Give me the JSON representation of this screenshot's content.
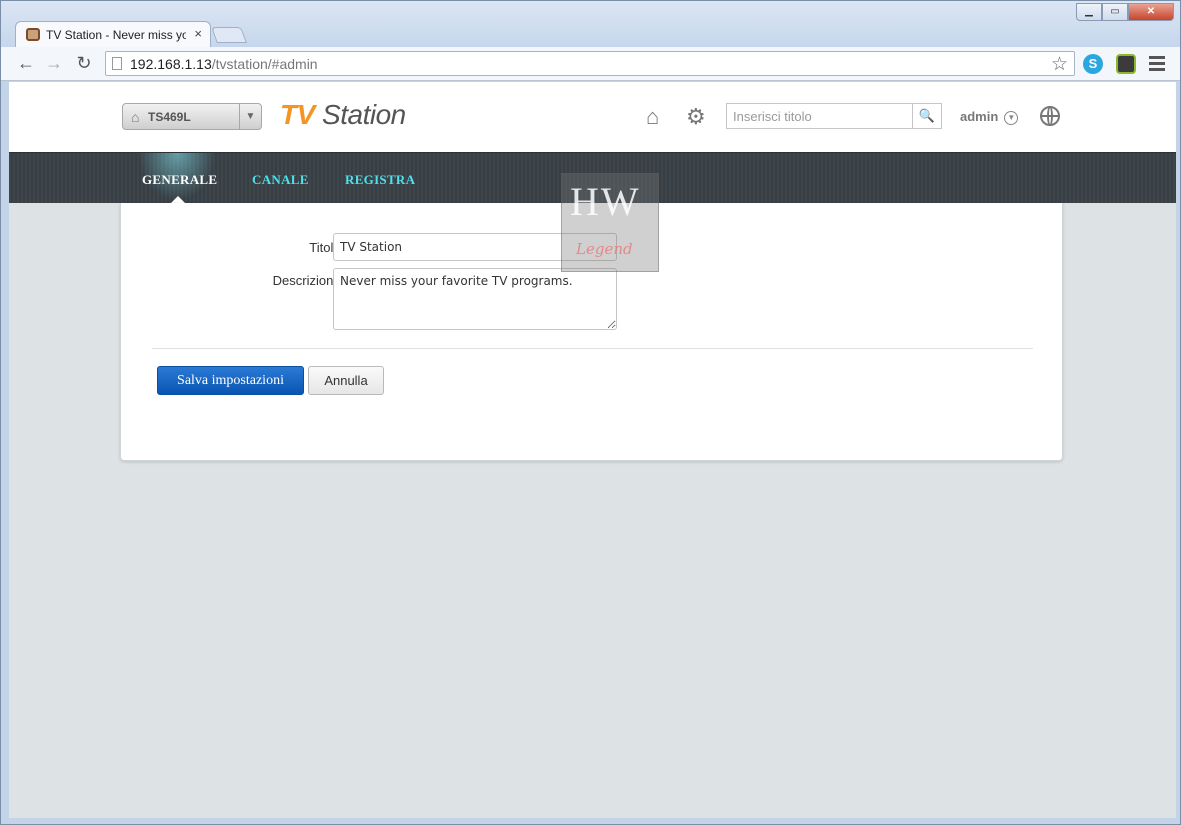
{
  "browser": {
    "tab_title": "TV Station - Never miss your favorite TV programs",
    "tab_close": "×",
    "url_host": "192.168.1.13",
    "url_path": "/tvstation/#admin",
    "window_buttons": {
      "minimize": "▁",
      "maximize": "▭",
      "close": "✕"
    }
  },
  "header": {
    "nas_name": "TS469L",
    "logo_tv": "TV",
    "logo_station": " Station",
    "search_placeholder": "Inserisci titolo",
    "user": "admin"
  },
  "nav": {
    "items": [
      {
        "label": "GENERALE",
        "active": true
      },
      {
        "label": "CANALE",
        "active": false
      },
      {
        "label": "REGISTRA",
        "active": false
      }
    ]
  },
  "form": {
    "title_label": "Titolo di TV Station:",
    "title_value": "TV Station",
    "description_label": "Descrizione di TV Station:",
    "description_value": "Never miss your favorite TV programs.",
    "save_label": "Salva impostazioni",
    "cancel_label": "Annulla"
  },
  "watermark": {
    "top": "HW",
    "bottom": "Legend"
  },
  "colors": {
    "accent": "#f39423",
    "nav_link": "#4fe0ea",
    "primary_button": "#0a55b3",
    "navbar_bg": "#3e464c"
  }
}
